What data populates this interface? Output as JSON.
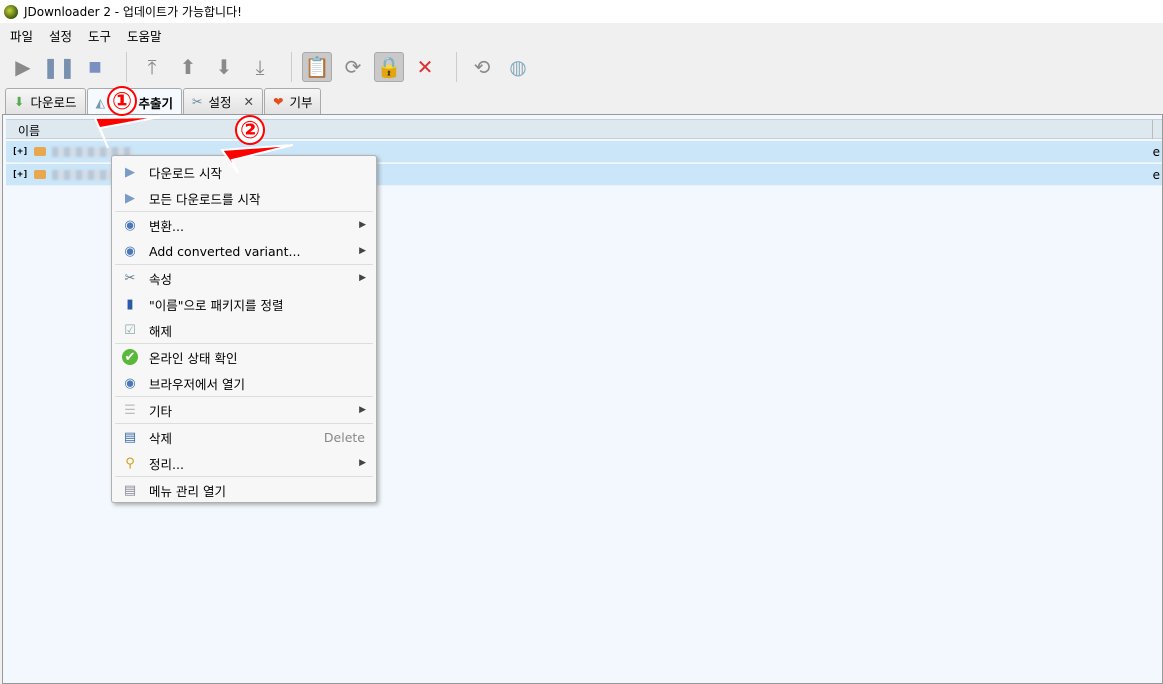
{
  "window": {
    "title": "JDownloader 2 - 업데이트가 가능합니다!"
  },
  "menubar": [
    "파일",
    "설정",
    "도구",
    "도움말"
  ],
  "toolbar": {
    "icons": [
      "play-icon",
      "pause-icon",
      "stop-icon",
      "move-top-icon",
      "move-up-icon",
      "move-down-icon",
      "move-bottom-icon",
      "clipboard-observer-icon",
      "reconnect-icon",
      "premium-lock-icon",
      "silent-mode-icon",
      "auto-reconnect-icon",
      "update-icon"
    ]
  },
  "tabs": [
    {
      "label": "다운로드"
    },
    {
      "label": "링크 추출기",
      "active": true
    },
    {
      "label": "설정",
      "closable": true
    },
    {
      "label": "기부"
    }
  ],
  "table": {
    "columns": [
      "이름"
    ],
    "rows": [
      {
        "expander": "[+]",
        "tail": "e"
      },
      {
        "expander": "[+]",
        "tail": "e"
      }
    ]
  },
  "context_menu": {
    "items": [
      {
        "label": "다운로드 시작",
        "icon": "play-add-icon"
      },
      {
        "label": "모든 다운로드를 시작",
        "icon": "play-add-icon"
      },
      {
        "sep": true
      },
      {
        "label": "변환...",
        "icon": "globe-icon",
        "submenu": true
      },
      {
        "label": "Add converted variant...",
        "icon": "globe-add-icon",
        "submenu": true
      },
      {
        "sep": true
      },
      {
        "label": "속성",
        "icon": "tools-icon",
        "submenu": true
      },
      {
        "label": "\"이름\"으로 패키지를 정렬",
        "icon": "sort-icon"
      },
      {
        "label": "해제",
        "icon": "checkbox-icon"
      },
      {
        "sep": true
      },
      {
        "label": "온라인 상태 확인",
        "icon": "check-circle-icon"
      },
      {
        "label": "브라우저에서 열기",
        "icon": "globe-icon"
      },
      {
        "sep": true
      },
      {
        "label": "기타",
        "icon": "list-icon",
        "submenu": true
      },
      {
        "sep": true
      },
      {
        "label": "삭제",
        "icon": "delete-icon",
        "shortcut": "Delete"
      },
      {
        "label": "정리...",
        "icon": "broom-icon",
        "submenu": true
      },
      {
        "sep": true
      },
      {
        "label": "메뉴 관리 열기",
        "icon": "menu-manager-icon"
      }
    ]
  },
  "annotations": [
    "①",
    "②"
  ],
  "colors": {
    "selection": "#cbe6f8",
    "annotation": "#ff0000"
  }
}
